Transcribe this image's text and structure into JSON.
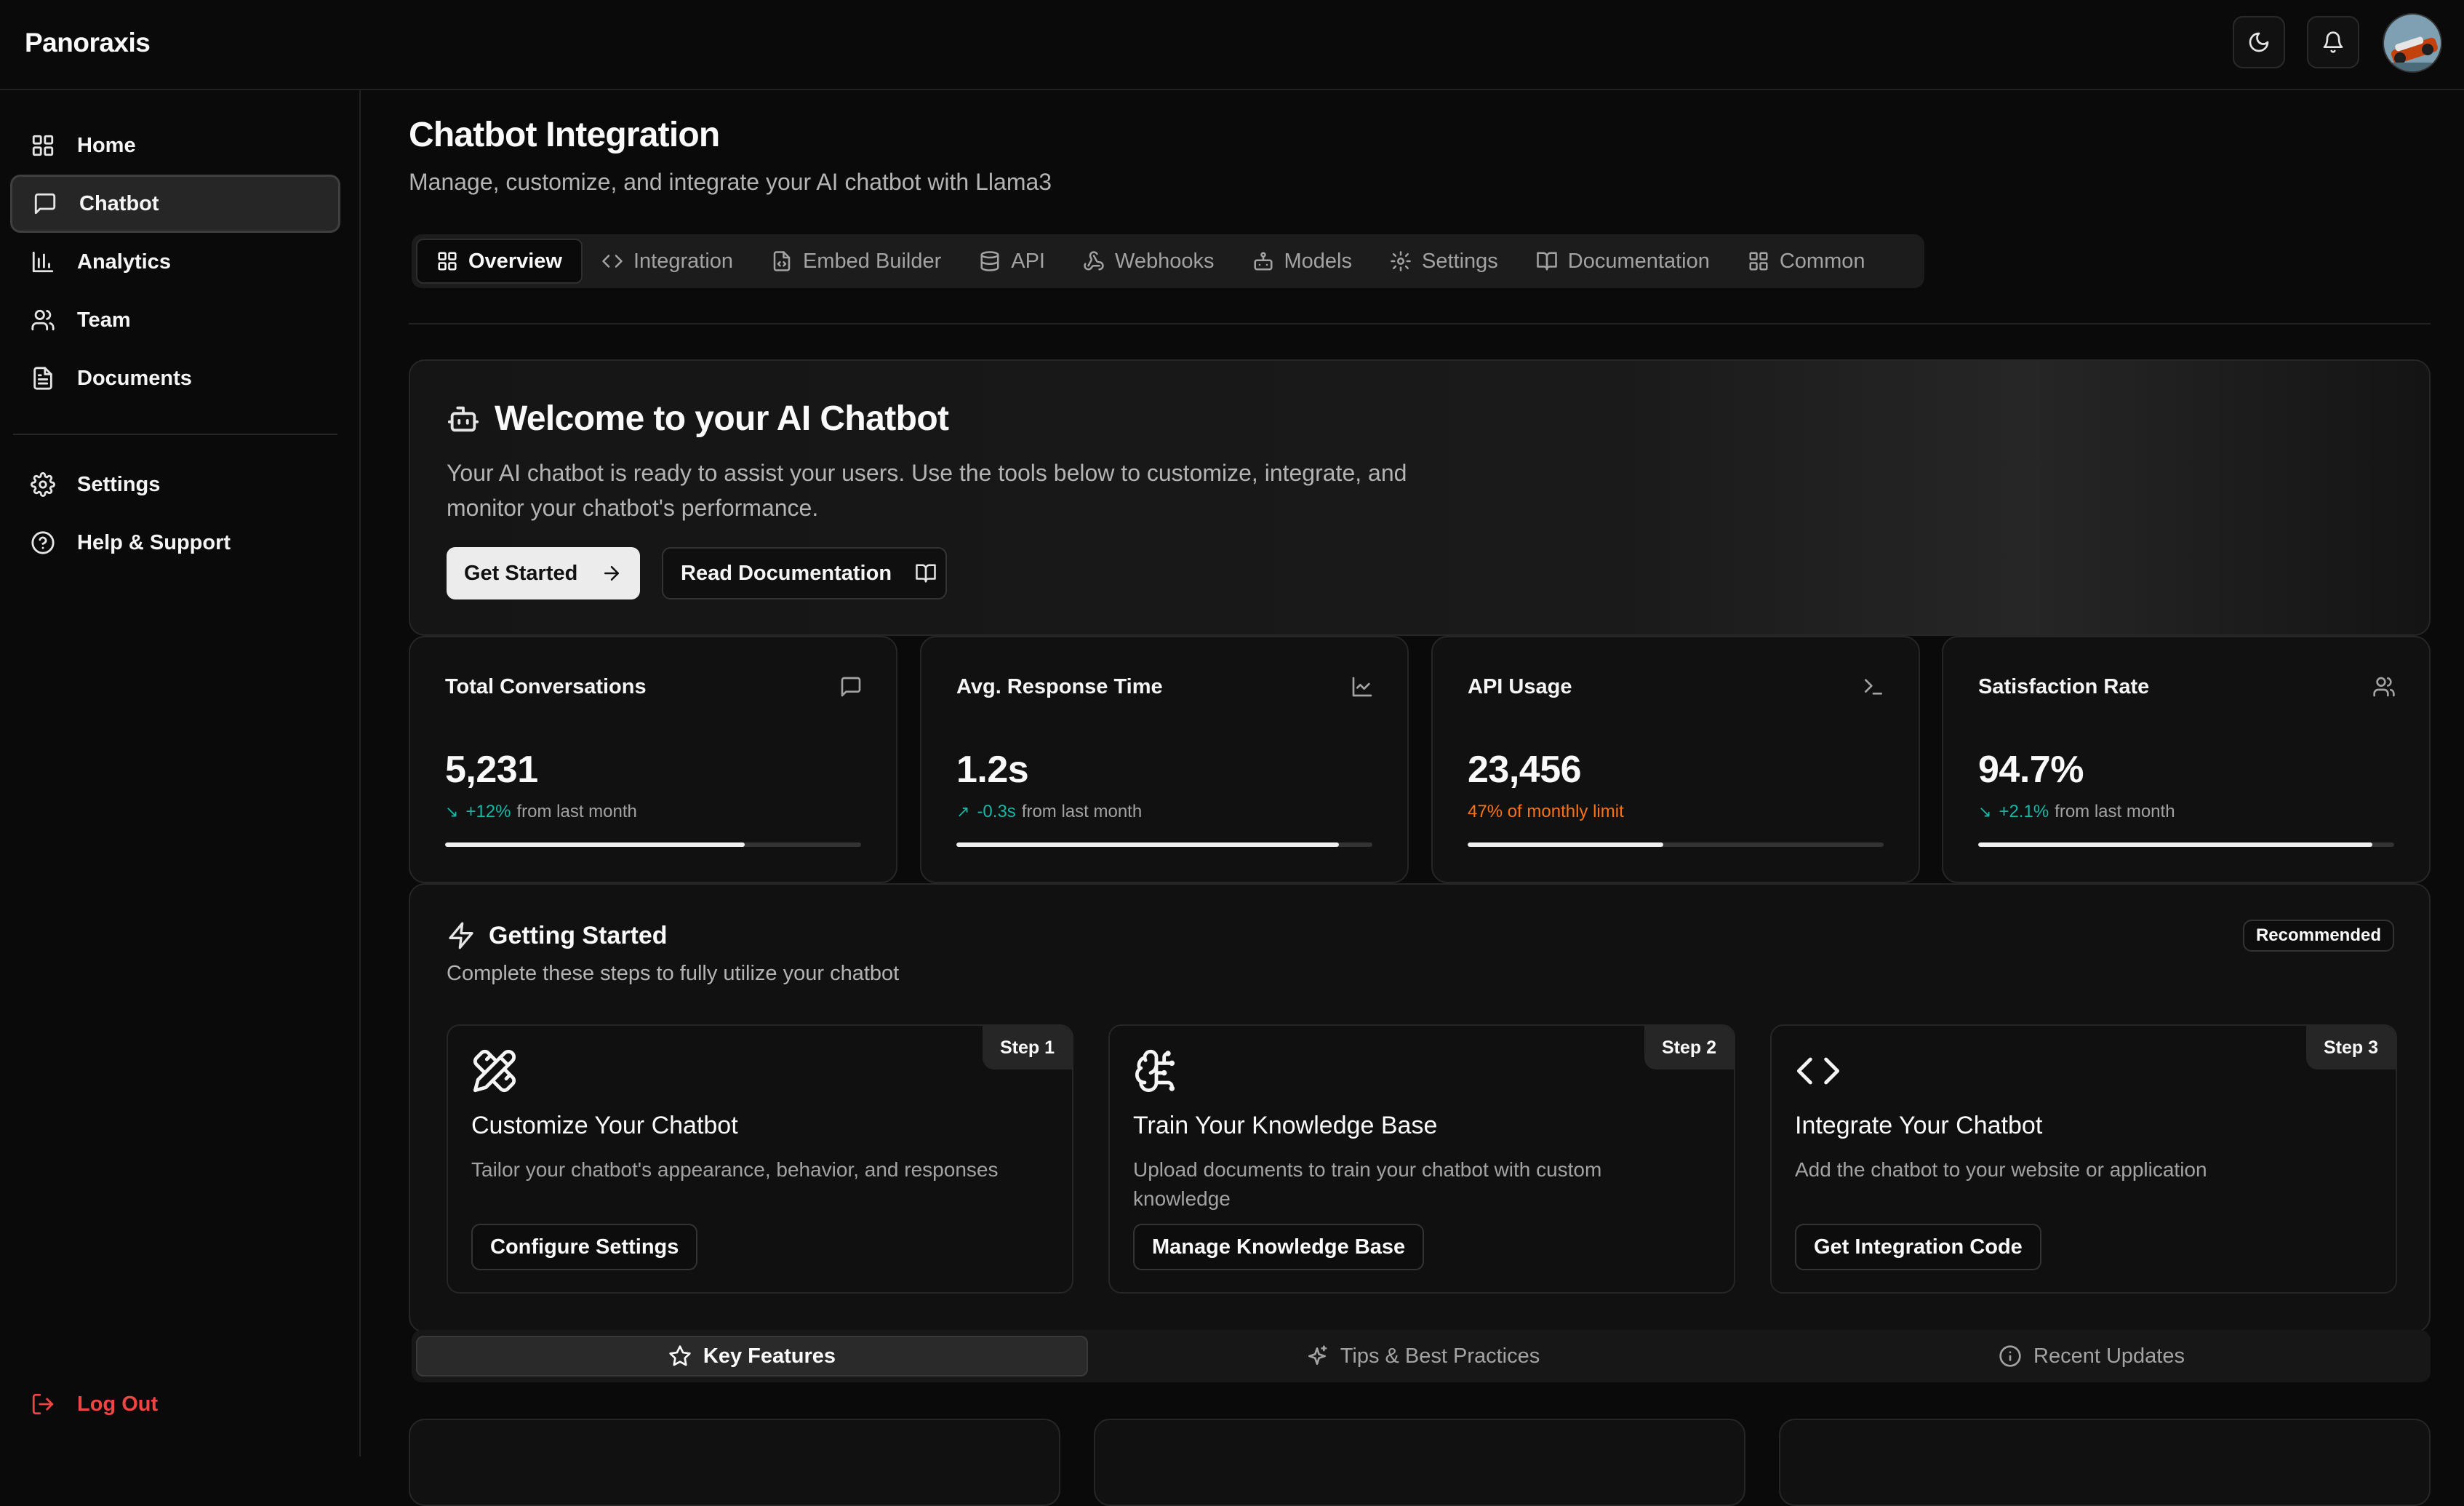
{
  "app": {
    "brand": "Panoraxis"
  },
  "topbar": {
    "theme_icon": "moon-icon",
    "notification_icon": "bell-icon"
  },
  "sidebar": {
    "items": [
      {
        "label": "Home",
        "icon": "layout-grid-icon",
        "active": false
      },
      {
        "label": "Chatbot",
        "icon": "message-square-icon",
        "active": true
      },
      {
        "label": "Analytics",
        "icon": "bar-chart-icon",
        "active": false
      },
      {
        "label": "Team",
        "icon": "users-icon",
        "active": false
      },
      {
        "label": "Documents",
        "icon": "file-text-icon",
        "active": false
      }
    ],
    "secondary": [
      {
        "label": "Settings",
        "icon": "gear-icon"
      },
      {
        "label": "Help & Support",
        "icon": "help-circle-icon"
      }
    ],
    "logout": "Log Out"
  },
  "header": {
    "title": "Chatbot Integration",
    "subtitle": "Manage, customize, and integrate your AI chatbot with Llama3"
  },
  "tabs": [
    {
      "label": "Overview",
      "icon": "layout-grid-icon",
      "active": true
    },
    {
      "label": "Integration",
      "icon": "code-icon",
      "active": false
    },
    {
      "label": "Embed Builder",
      "icon": "file-code-icon",
      "active": false
    },
    {
      "label": "API",
      "icon": "database-icon",
      "active": false
    },
    {
      "label": "Webhooks",
      "icon": "webhook-icon",
      "active": false
    },
    {
      "label": "Models",
      "icon": "bot-icon",
      "active": false
    },
    {
      "label": "Settings",
      "icon": "gear-icon",
      "active": false
    },
    {
      "label": "Documentation",
      "icon": "book-open-icon",
      "active": false
    },
    {
      "label": "Common",
      "icon": "layout-grid-icon",
      "active": false
    }
  ],
  "welcome": {
    "title": "Welcome to your AI Chatbot",
    "description": "Your AI chatbot is ready to assist your users. Use the tools below to customize, integrate, and monitor your chatbot's performance.",
    "primary_button": "Get Started",
    "secondary_button": "Read Documentation"
  },
  "stats": [
    {
      "label": "Total Conversations",
      "value": "5,231",
      "delta": "+12%",
      "suffix": "from last month",
      "progress": 0.72,
      "icon": "message-square-icon"
    },
    {
      "label": "Avg. Response Time",
      "value": "1.2s",
      "delta": "-0.3s",
      "suffix": "from last month",
      "progress": 0.92,
      "icon": "line-chart-icon"
    },
    {
      "label": "API Usage",
      "value": "23,456",
      "delta": "47% of monthly limit",
      "suffix": "",
      "progress": 0.47,
      "icon": "terminal-icon"
    },
    {
      "label": "Satisfaction Rate",
      "value": "94.7%",
      "delta": "+2.1%",
      "suffix": "from last month",
      "progress": 0.947,
      "icon": "users-icon"
    }
  ],
  "getting_started": {
    "title": "Getting Started",
    "subtitle": "Complete these steps to fully utilize your chatbot",
    "badge": "Recommended",
    "steps": [
      {
        "badge": "Step 1",
        "title": "Customize Your Chatbot",
        "description": "Tailor your chatbot's appearance, behavior, and responses",
        "button": "Configure Settings",
        "icon": "pencil-ruler-icon"
      },
      {
        "badge": "Step 2",
        "title": "Train Your Knowledge Base",
        "description": "Upload documents to train your chatbot with custom knowledge",
        "button": "Manage Knowledge Base",
        "icon": "brain-icon"
      },
      {
        "badge": "Step 3",
        "title": "Integrate Your Chatbot",
        "description": "Add the chatbot to your website or application",
        "button": "Get Integration Code",
        "icon": "code-icon"
      }
    ]
  },
  "feature_tabs": [
    {
      "label": "Key Features",
      "icon": "star-icon",
      "active": true
    },
    {
      "label": "Tips & Best Practices",
      "icon": "sparkles-icon",
      "active": false
    },
    {
      "label": "Recent Updates",
      "icon": "info-icon",
      "active": false
    }
  ],
  "colors": {
    "accent_positive": "#14b8a6",
    "accent_warning": "#f97316",
    "logout": "#ef4444",
    "background": "#0a0a0a"
  }
}
